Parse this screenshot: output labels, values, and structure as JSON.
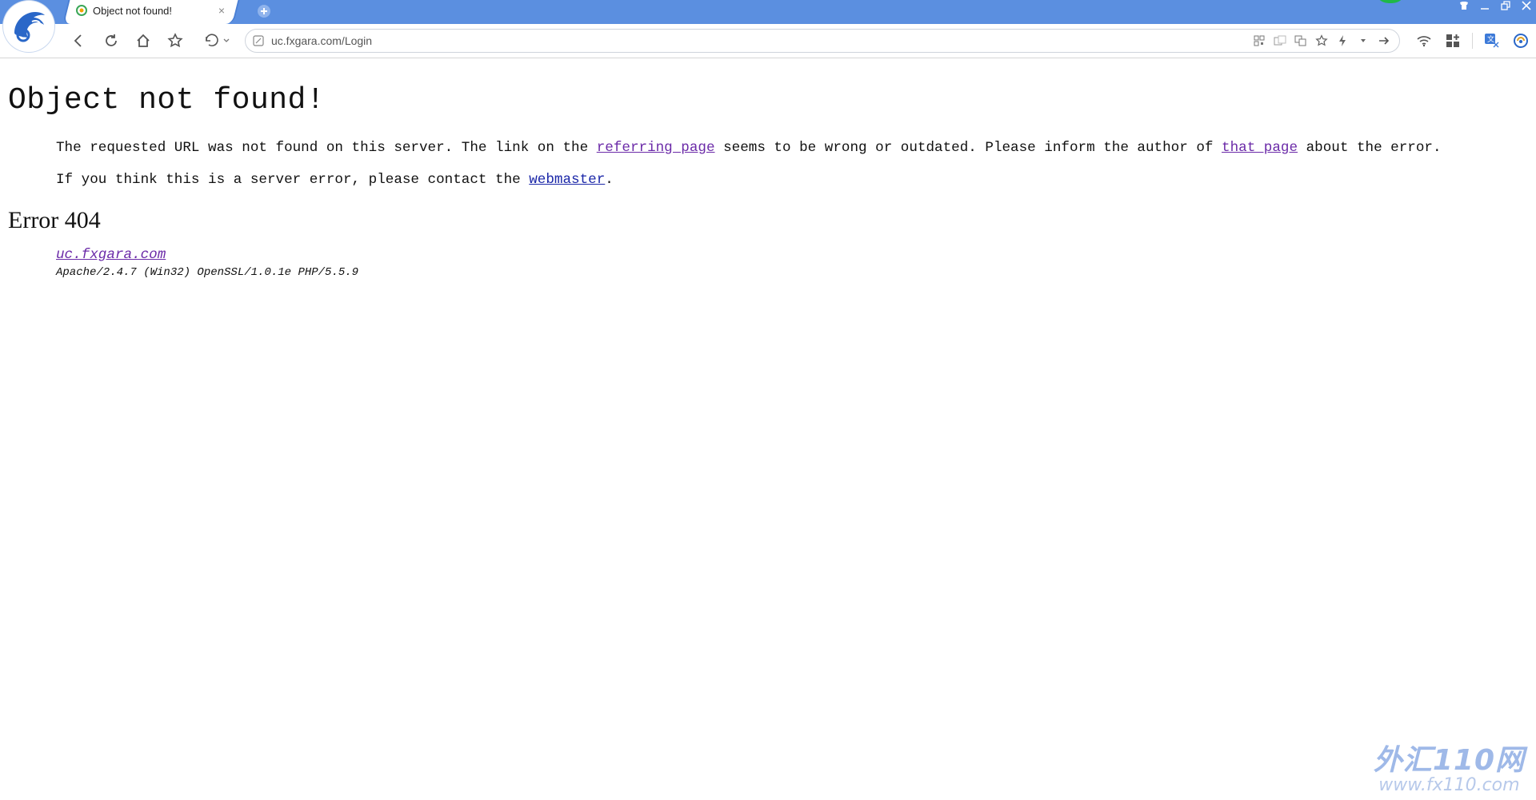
{
  "browser": {
    "tab": {
      "title": "Object not found!"
    },
    "address": {
      "url": "uc.fxgara.com/Login"
    },
    "colors": {
      "tabbar": "#5b8fe0",
      "link_visited": "#6b2aa8",
      "link": "#1b27a8"
    }
  },
  "page": {
    "heading": "Object not found!",
    "para1": {
      "text1": "The requested URL was not found on this server. The link on the ",
      "link1": "referring page",
      "text2": " seems to be wrong or outdated. Please inform the author of ",
      "link2": "that page",
      "text3": " about the error."
    },
    "para2": {
      "text1": "If you think this is a server error, please contact the ",
      "link": "webmaster",
      "text2": "."
    },
    "error_heading": "Error 404",
    "address": {
      "host_link": "uc.fxgara.com",
      "server_signature": "Apache/2.4.7 (Win32) OpenSSL/1.0.1e PHP/5.5.9"
    }
  },
  "watermark": {
    "main": "外汇110网",
    "sub": "www.fx110.com"
  }
}
